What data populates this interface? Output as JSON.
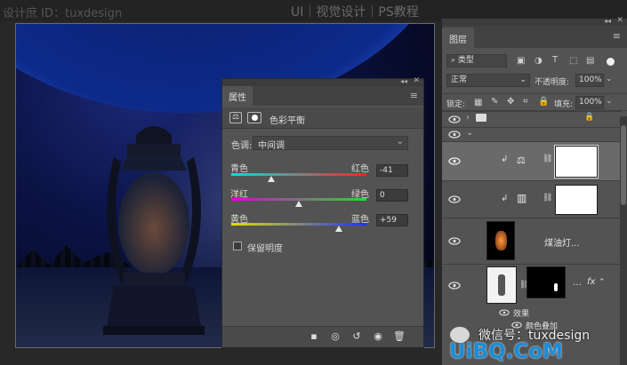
{
  "top": {
    "watermark": "设计庶 ID：tuxdesign",
    "center_title": "UI｜视觉设计｜PS教程"
  },
  "properties": {
    "tab": "属性",
    "title": "色彩平衡",
    "tone_label": "色调:",
    "tone_value": "中间调",
    "sliders": [
      {
        "left": "青色",
        "right": "红色",
        "value": "-41",
        "level": -41
      },
      {
        "left": "洋红",
        "right": "绿色",
        "value": "0",
        "level": 0
      },
      {
        "left": "黄色",
        "right": "蓝色",
        "value": "+59",
        "level": 59
      }
    ],
    "preserve_label": "保留明度"
  },
  "layers": {
    "tab": "图层",
    "filter_kind": "类型",
    "blend_mode": "正常",
    "opacity_label": "不透明度:",
    "opacity_value": "100%",
    "lock_label": "锁定:",
    "fill_label": "填充:",
    "fill_value": "100%",
    "items": [
      {
        "name": "煤油灯..."
      },
      {
        "fx": "fx"
      }
    ],
    "effects_label": "效果",
    "effect_item": "颜色叠加"
  },
  "watermarks": {
    "wechat": "微信号：tuxdesign",
    "site": "UiBQ.CoM"
  },
  "colors": {
    "panel": "#535353",
    "topbar": "#232323",
    "site_blue": "#1a8cd8"
  }
}
